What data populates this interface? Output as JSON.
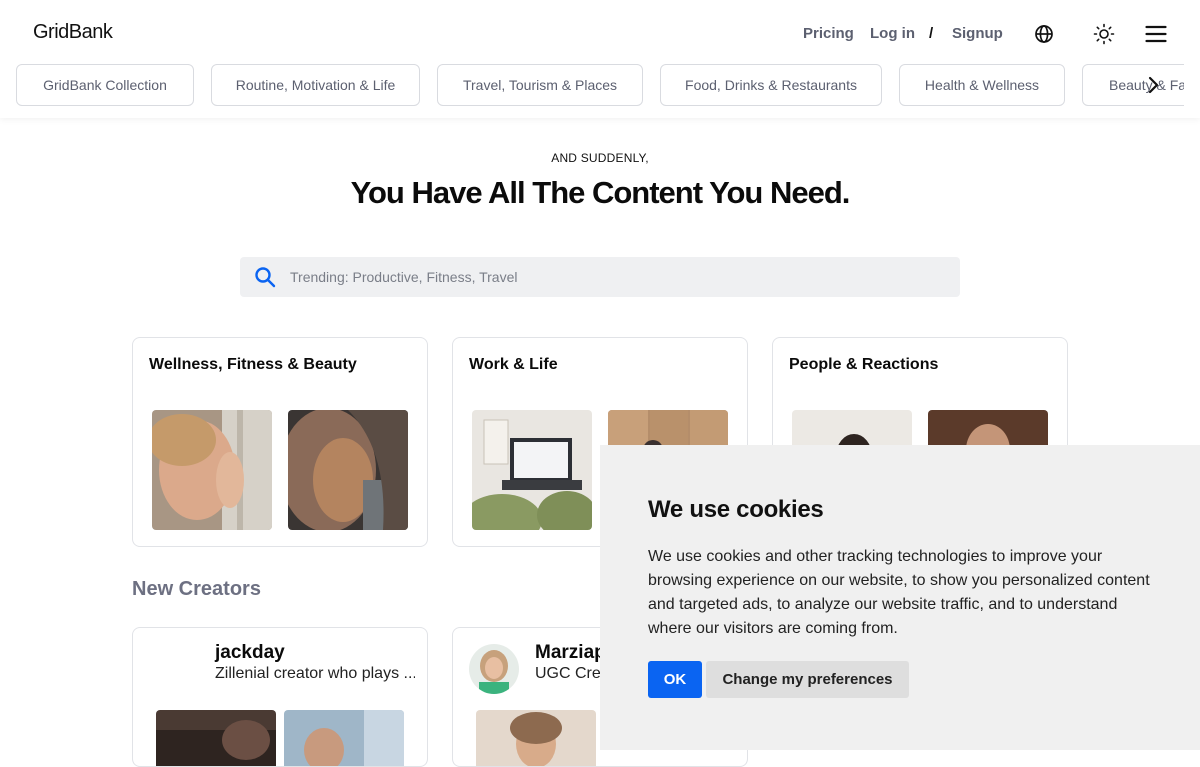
{
  "brand": {
    "name": "GridBank"
  },
  "nav": {
    "pricing": "Pricing",
    "login": "Log in",
    "separator": "/",
    "signup": "Signup",
    "icons": [
      "globe-icon",
      "sun-icon",
      "menu-icon"
    ]
  },
  "categories": [
    "GridBank Collection",
    "Routine, Motivation & Life",
    "Travel, Tourism & Places",
    "Food, Drinks & Restaurants",
    "Health & Wellness",
    "Beauty & Fashion"
  ],
  "hero": {
    "eyebrow": "AND SUDDENLY,",
    "headline": "You Have All The Content You Need."
  },
  "search": {
    "placeholder": "Trending: Productive, Fitness, Travel"
  },
  "collections": [
    {
      "title": "Wellness, Fitness & Beauty"
    },
    {
      "title": "Work & Life"
    },
    {
      "title": "People & Reactions"
    }
  ],
  "new_creators": {
    "title": "New Creators",
    "creators": [
      {
        "name": "jackday",
        "bio": "Zillenial creator who plays ..."
      },
      {
        "name": "Marziap",
        "bio": "UGC Crea"
      }
    ]
  },
  "cookie": {
    "title": "We use cookies",
    "body": "We use cookies and other tracking technologies to improve your browsing experience on our website, to show you personalized content and targeted ads, to analyze our website traffic, and to understand where our visitors are coming from.",
    "ok_label": "OK",
    "prefs_label": "Change my preferences"
  },
  "colors": {
    "accent": "#0a64f2",
    "nav_text": "#5c6070",
    "section_title": "#6d7082",
    "cookie_bg": "#f0f0f0"
  }
}
